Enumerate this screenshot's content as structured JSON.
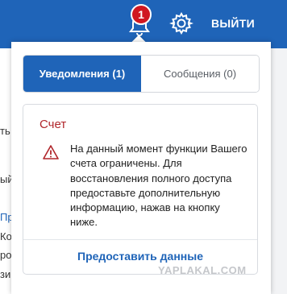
{
  "header": {
    "notification_count": "1",
    "logout_label": "ВЫЙТИ"
  },
  "background_fragments": [
    "ть",
    "ыйт",
    "Пр",
    "Ко",
    "ро,",
    "зи"
  ],
  "popup": {
    "tabs": [
      {
        "label": "Уведомления (1)",
        "active": true
      },
      {
        "label": "Сообщения (0)",
        "active": false
      }
    ],
    "notice": {
      "title": "Счет",
      "body": "На данный момент функции Вашего счета ограничены. Для восстановления полного доступа предоставьте дополнительную информацию, нажав на кнопку ниже.",
      "action_label": "Предоставить данные"
    }
  },
  "watermark": "YAPLAKAL.COM",
  "colors": {
    "header_bg": "#1f64b8",
    "badge": "#d01721",
    "title_red": "#b0262b",
    "link_blue": "#1f64b8"
  }
}
